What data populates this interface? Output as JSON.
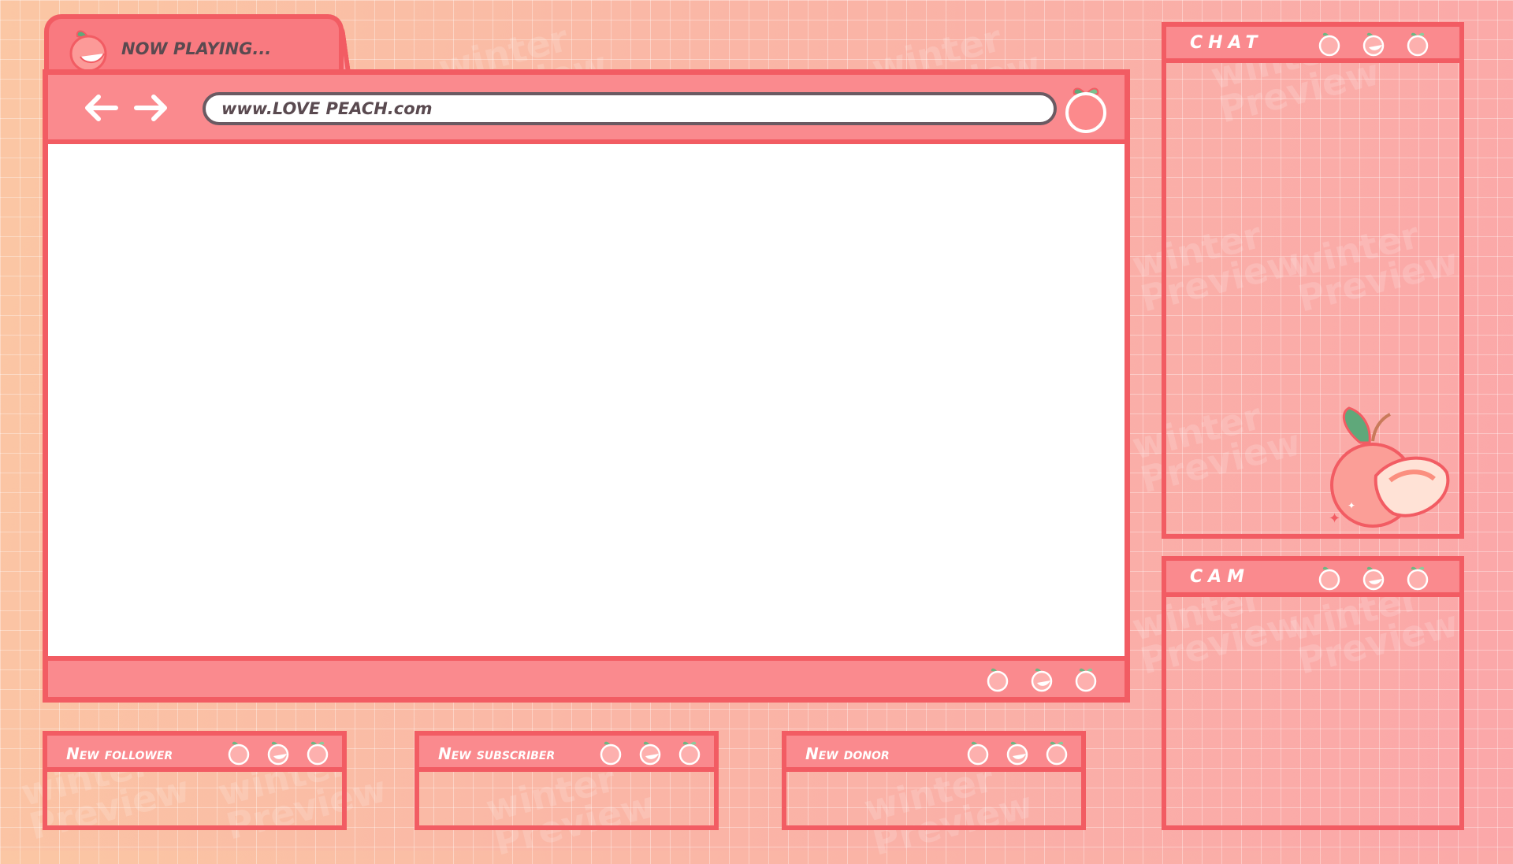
{
  "tab": {
    "label": "NOW PLAYING..."
  },
  "browser": {
    "url": "www.LOVE PEACH.com"
  },
  "panels": {
    "chat": "CHAT",
    "cam": "CAM",
    "follower": "New follower",
    "subscriber": "New subscriber",
    "donor": "New donor"
  },
  "watermark": {
    "line1": "winter",
    "line2": "Preview"
  },
  "colors": {
    "frame": "#f25c63",
    "header": "#fa8a8e",
    "text": "#5a4a50"
  },
  "icons": [
    "peach-icon",
    "arrow-left-icon",
    "arrow-right-icon"
  ]
}
